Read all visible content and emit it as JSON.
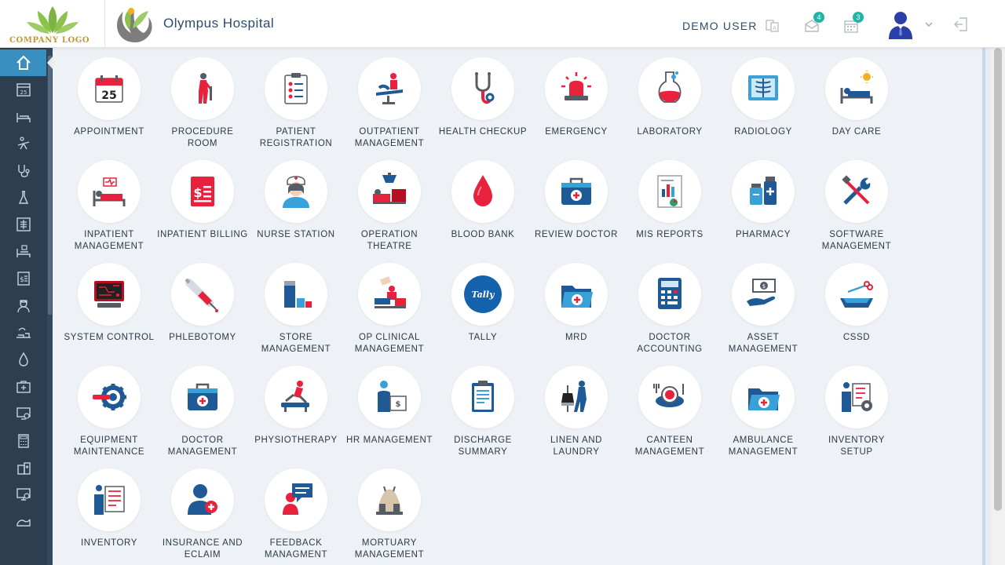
{
  "header": {
    "company_logo_text": "COMPANY LOGO",
    "hospital_name": "Olympus Hospital",
    "user_name": "DEMO USER",
    "mail_count": "4",
    "calendar_count": "3"
  },
  "sidebar": {
    "icons": [
      "home-icon",
      "calendar-icon",
      "bed-icon",
      "procedure-icon",
      "stethoscope-icon",
      "lab-icon",
      "radiology-icon",
      "daycare-bed-icon",
      "billing-icon",
      "nurse-icon",
      "operation-icon",
      "blood-drop-icon",
      "first-aid-icon",
      "monitor-settings-icon",
      "calculator-icon",
      "pharmacy-icon",
      "computer-icon",
      "tally-icon"
    ]
  },
  "modules": [
    {
      "label": "APPOINTMENT",
      "icon": "appointment-icon"
    },
    {
      "label": "PROCEDURE ROOM",
      "icon": "procedure-room-icon"
    },
    {
      "label": "PATIENT REGISTRATION",
      "icon": "patient-registration-icon"
    },
    {
      "label": "OUTPATIENT MANAGEMENT",
      "icon": "outpatient-icon"
    },
    {
      "label": "HEALTH CHECKUP",
      "icon": "stethoscope-icon"
    },
    {
      "label": "EMERGENCY",
      "icon": "siren-icon"
    },
    {
      "label": "LABORATORY",
      "icon": "flask-icon"
    },
    {
      "label": "RADIOLOGY",
      "icon": "xray-icon"
    },
    {
      "label": "DAY CARE",
      "icon": "day-care-icon"
    },
    {
      "label": "INPATIENT MANAGEMENT",
      "icon": "inpatient-bed-icon"
    },
    {
      "label": "INPATIENT BILLING",
      "icon": "billing-icon"
    },
    {
      "label": "NURSE STATION",
      "icon": "nurse-icon"
    },
    {
      "label": "OPERATION THEATRE",
      "icon": "operation-theatre-icon"
    },
    {
      "label": "BLOOD BANK",
      "icon": "blood-drop-icon"
    },
    {
      "label": "REVIEW DOCTOR",
      "icon": "medical-kit-icon"
    },
    {
      "label": "MIS REPORTS",
      "icon": "report-chart-icon"
    },
    {
      "label": "PHARMACY",
      "icon": "pharmacy-bottles-icon"
    },
    {
      "label": "SOFTWARE MANAGEMENT",
      "icon": "tools-icon"
    },
    {
      "label": "SYSTEM CONTROL",
      "icon": "system-monitor-icon"
    },
    {
      "label": "PHLEBOTOMY",
      "icon": "syringe-icon"
    },
    {
      "label": "STORE MANAGEMENT",
      "icon": "store-icon"
    },
    {
      "label": "OP CLINICAL MANAGEMENT",
      "icon": "op-clinical-icon"
    },
    {
      "label": "TALLY",
      "icon": "tally-icon",
      "text": "Tally"
    },
    {
      "label": "MRD",
      "icon": "folder-medical-icon"
    },
    {
      "label": "DOCTOR ACCOUNTING",
      "icon": "calculator-icon"
    },
    {
      "label": "ASSET MANAGEMENT",
      "icon": "asset-hand-icon"
    },
    {
      "label": "CSSD",
      "icon": "cssd-tray-icon"
    },
    {
      "label": "EQUIPMENT MAINTENANCE",
      "icon": "gear-icon"
    },
    {
      "label": "DOCTOR MANAGEMENT",
      "icon": "doctor-kit-icon"
    },
    {
      "label": "PHYSIOTHERAPY",
      "icon": "physiotherapy-icon"
    },
    {
      "label": "HR MANAGEMENT",
      "icon": "hr-icon"
    },
    {
      "label": "DISCHARGE SUMMARY",
      "icon": "clipboard-icon"
    },
    {
      "label": "LINEN AND LAUNDRY",
      "icon": "laundry-icon"
    },
    {
      "label": "CANTEEN MANAGEMENT",
      "icon": "canteen-icon"
    },
    {
      "label": "AMBULANCE MANAGEMENT",
      "icon": "ambulance-folder-icon"
    },
    {
      "label": "INVENTORY SETUP",
      "icon": "inventory-setup-icon"
    },
    {
      "label": "INVENTORY",
      "icon": "inventory-icon"
    },
    {
      "label": "INSURANCE AND ECLAIM",
      "icon": "insurance-icon"
    },
    {
      "label": "FEEDBACK MANAGMENT",
      "icon": "feedback-icon"
    },
    {
      "label": "MORTUARY MANAGEMENT",
      "icon": "mortuary-icon"
    }
  ],
  "day_number": "25"
}
